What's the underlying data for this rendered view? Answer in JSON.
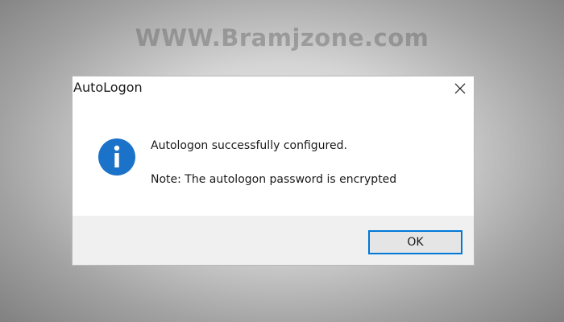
{
  "watermark": "WWW.Bramjzone.com",
  "dialog": {
    "title": "AutoLogon",
    "message": "Autologon successfully configured.",
    "note": "Note: The autologon password is encrypted",
    "ok_label": "OK",
    "icon": "info-icon",
    "close_icon": "close-icon"
  },
  "colors": {
    "accent": "#0078d7",
    "icon_blue": "#1a73c9",
    "footer_bg": "#f0f0f0",
    "button_bg": "#e5e5e5"
  }
}
